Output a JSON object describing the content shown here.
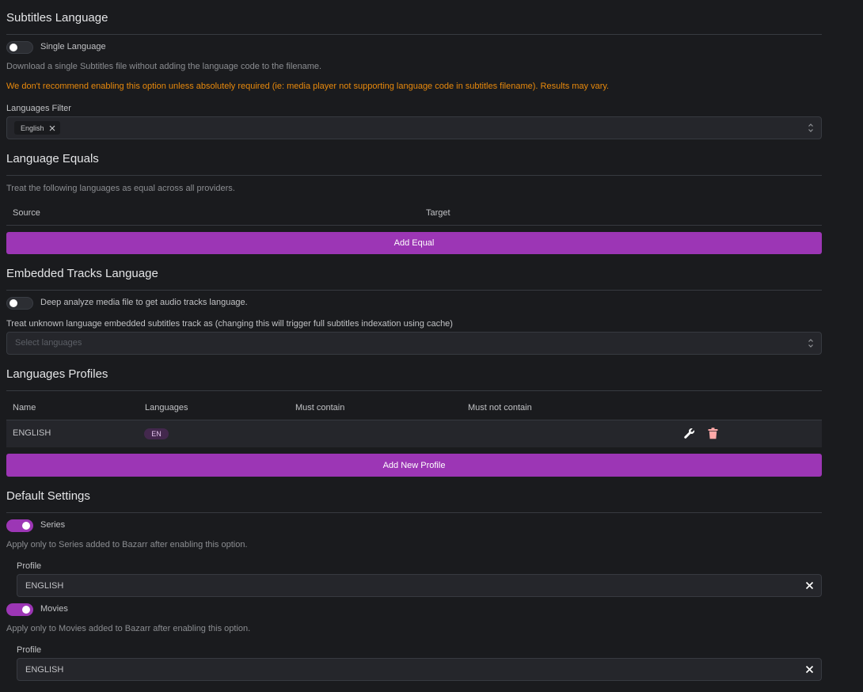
{
  "subtitles_language": {
    "title": "Subtitles Language",
    "single_language": {
      "label": "Single Language",
      "enabled": false
    },
    "description": "Download a single Subtitles file without adding the language code to the filename.",
    "warning": "We don't recommend enabling this option unless absolutely required (ie: media player not supporting language code in subtitles filename). Results may vary.",
    "languages_filter": {
      "label": "Languages Filter",
      "selected": [
        "English"
      ]
    }
  },
  "language_equals": {
    "title": "Language Equals",
    "description": "Treat the following languages as equal across all providers.",
    "columns": [
      "Source",
      "Target"
    ],
    "add_button": "Add Equal"
  },
  "embedded_tracks": {
    "title": "Embedded Tracks Language",
    "deep_analyze": {
      "label": "Deep analyze media file to get audio tracks language.",
      "enabled": false
    },
    "unknown_label": "Treat unknown language embedded subtitles track as (changing this will trigger full subtitles indexation using cache)",
    "select_placeholder": "Select languages"
  },
  "profiles": {
    "title": "Languages Profiles",
    "columns": [
      "Name",
      "Languages",
      "Must contain",
      "Must not contain"
    ],
    "rows": [
      {
        "name": "ENGLISH",
        "languages": [
          "EN"
        ]
      }
    ],
    "add_button": "Add New Profile"
  },
  "defaults": {
    "title": "Default Settings",
    "series": {
      "label": "Series",
      "enabled": true,
      "description": "Apply only to Series added to Bazarr after enabling this option.",
      "profile_label": "Profile",
      "profile_value": "ENGLISH"
    },
    "movies": {
      "label": "Movies",
      "enabled": true,
      "description": "Apply only to Movies added to Bazarr after enabling this option.",
      "profile_label": "Profile",
      "profile_value": "ENGLISH"
    }
  },
  "colors": {
    "accent": "#9c36b5",
    "warning": "#e8890c",
    "background": "#1a1b1e",
    "surface": "#25262b",
    "delete": "#ffa8a8"
  },
  "icons": {
    "edit": "wrench-icon",
    "delete": "trash-icon",
    "remove": "close-icon",
    "select": "chevron-up-down-icon"
  }
}
